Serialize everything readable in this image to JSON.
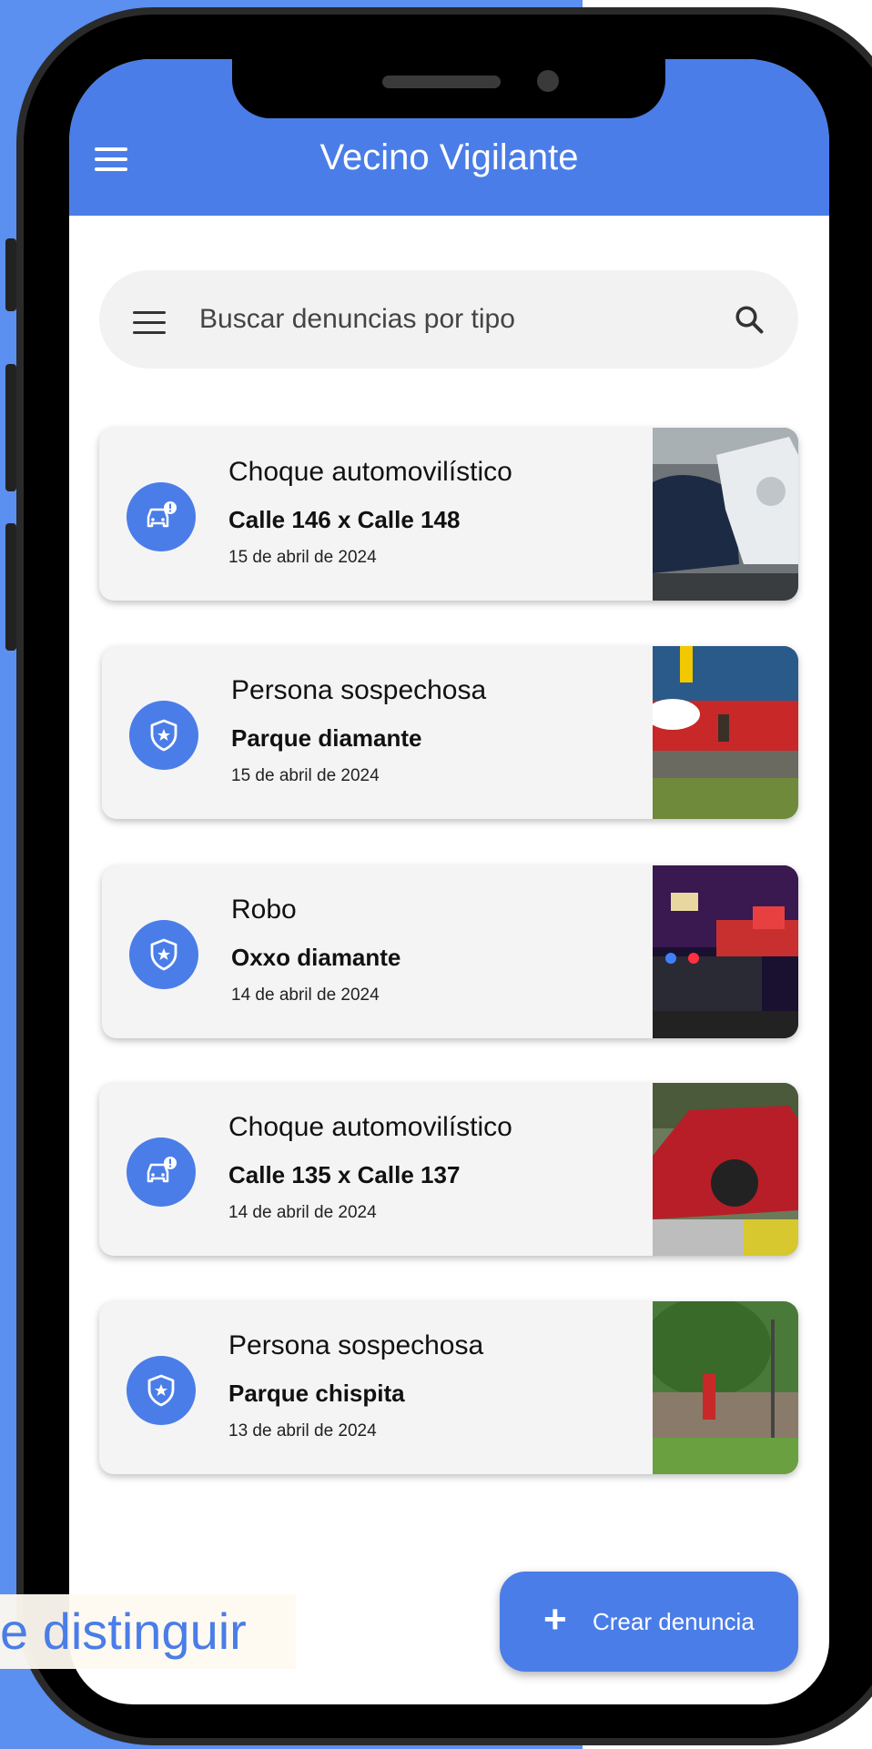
{
  "app": {
    "title": "Vecino Vigilante"
  },
  "search": {
    "placeholder": "Buscar denuncias por tipo"
  },
  "reports": [
    {
      "type": "Choque automovilístico",
      "location": "Calle 146 x Calle 148",
      "date": "15 de abril de 2024",
      "icon": "car-alert-icon"
    },
    {
      "type": "Persona sospechosa",
      "location": "Parque diamante",
      "date": "15 de abril de 2024",
      "icon": "shield-icon"
    },
    {
      "type": "Robo",
      "location": "Oxxo diamante",
      "date": "14 de abril de 2024",
      "icon": "shield-icon"
    },
    {
      "type": "Choque automovilístico",
      "location": "Calle 135 x Calle 137",
      "date": "14 de abril de 2024",
      "icon": "car-alert-icon"
    },
    {
      "type": "Persona sospechosa",
      "location": "Parque chispita",
      "date": "13 de abril de 2024",
      "icon": "shield-icon"
    }
  ],
  "fab": {
    "label": "Crear denuncia"
  },
  "overlay": {
    "text": "e distinguir"
  },
  "colors": {
    "primary": "#4a7de8",
    "background": "#5b8ff0",
    "card": "#f4f4f4"
  }
}
